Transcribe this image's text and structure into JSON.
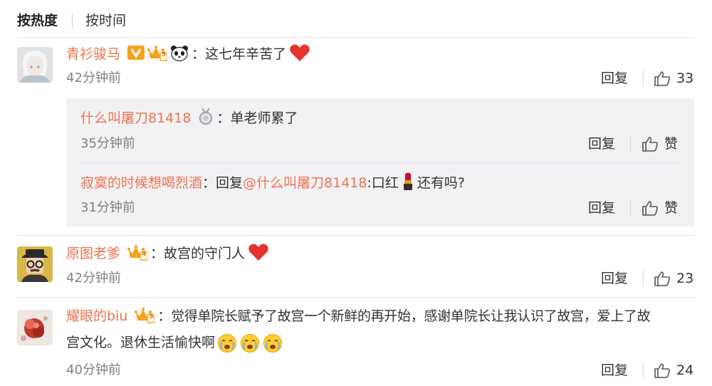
{
  "sort_tabs": [
    "按热度",
    "按时间"
  ],
  "actions": {
    "reply": "回复",
    "like": "赞"
  },
  "colors": {
    "username": "#eb7350",
    "time": "#808080",
    "text": "#333333",
    "heart": "#e5332d",
    "vip_badge": "#f7a21b"
  },
  "comments": [
    {
      "user": "青衫骏马",
      "badges": [
        "vip-v-badge",
        "crown-level-badge",
        "panda-emoji"
      ],
      "level": "5",
      "text": "：这七年辛苦了",
      "emoji": "heart-icon",
      "time": "42分钟前",
      "likes": "33",
      "replies": [
        {
          "user": "什么叫屠刀81418",
          "badge": "medal-badge",
          "text": "：单老师累了",
          "time": "35分钟前"
        },
        {
          "user": "寂寞的时候想喝烈酒",
          "prefix": "：回复",
          "mention": "@什么叫屠刀81418",
          "text": ":口红",
          "emoji": "lipstick-icon",
          "suffix": "还有吗?",
          "time": "31分钟前"
        }
      ]
    },
    {
      "user": "原图老爹",
      "badges": [
        "crown-level-badge"
      ],
      "level": "4",
      "text": "：故宫的守门人",
      "emoji": "heart-icon",
      "time": "42分钟前",
      "likes": "23"
    },
    {
      "user": "耀眼的biu",
      "badges": [
        "crown-level-badge"
      ],
      "level": "3",
      "text_line1": "：觉得单院长赋予了故宫一个新鲜的再开始，感谢单院长让我认识了故宫，爱上了故",
      "text_line2": "宫文化。退休生活愉快啊",
      "emoji": "crying-face-emoji",
      "time": "40分钟前",
      "likes": "24"
    }
  ]
}
